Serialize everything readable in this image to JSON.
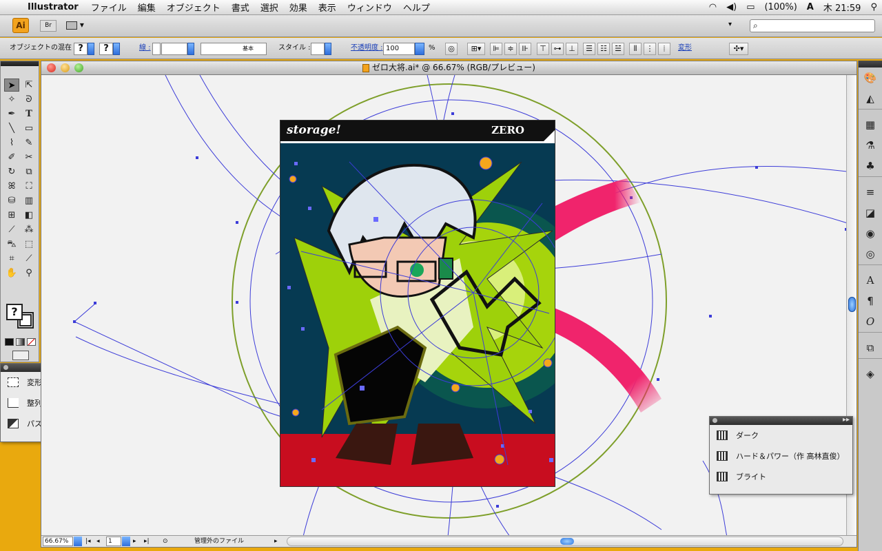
{
  "menubar": {
    "app_name": "Illustrator",
    "items": [
      "ファイル",
      "編集",
      "オブジェクト",
      "書式",
      "選択",
      "効果",
      "表示",
      "ウィンドウ",
      "ヘルプ"
    ],
    "battery": "(100%)",
    "input_method": "A",
    "clock": "木 21:59"
  },
  "appbar": {
    "logo": "Ai",
    "bridge": "Br"
  },
  "control": {
    "blend_label": "オブジェクトの混在",
    "q1": "?",
    "q2": "?",
    "stroke_label": "線 :",
    "brush_label": "基本",
    "style_label": "スタイル :",
    "opacity_label": "不透明度 :",
    "opacity_value": "100",
    "percent": "%",
    "transform_link": "変形"
  },
  "document": {
    "title": "ゼロ大将.ai* @ 66.67% (RGB/プレビュー)",
    "zoom": "66.67%",
    "page": "1",
    "status": "管理外のファイル"
  },
  "artwork": {
    "brand": "storage!",
    "name": "ZERO"
  },
  "left_panel": {
    "items": [
      "変形",
      "整列",
      "パスファインダ"
    ]
  },
  "right_panel": {
    "items": [
      "ダーク",
      "ハード＆パワー（作 高林直俊）",
      "ブライト"
    ]
  },
  "colors": {
    "accent_orange": "#f3a31e",
    "path_blue": "#3c3cd8",
    "lime": "#a6d40c",
    "pink": "#f0246c"
  }
}
